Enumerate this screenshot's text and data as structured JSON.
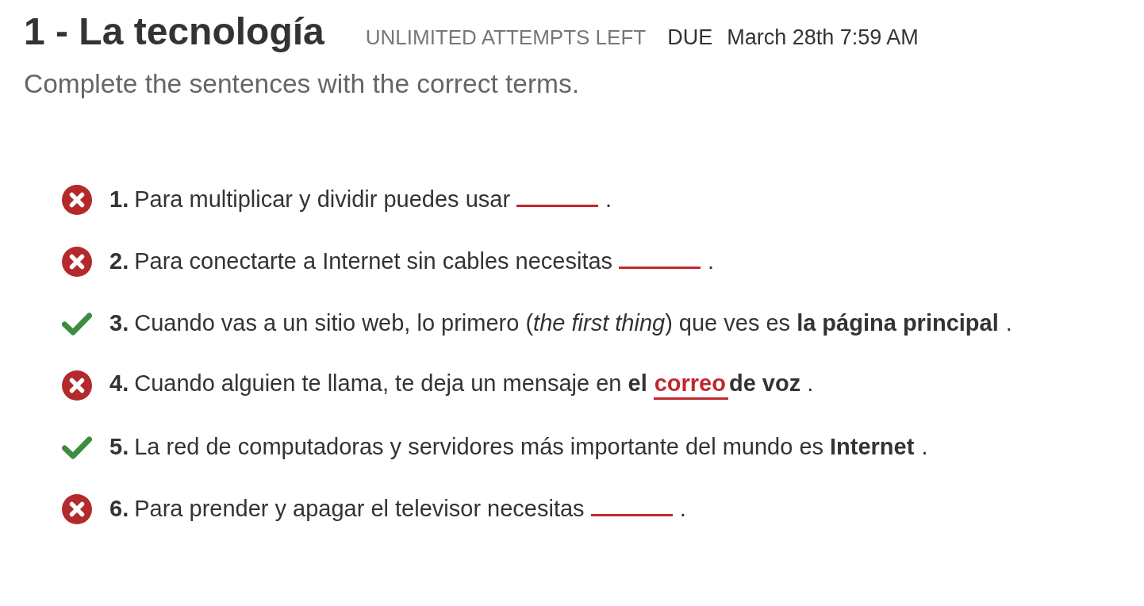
{
  "header": {
    "title": "1 - La tecnología",
    "attempts": "UNLIMITED ATTEMPTS LEFT",
    "due_label": "DUE",
    "due_date": "March 28th 7:59 AM"
  },
  "instructions": "Complete the sentences with the correct terms.",
  "items": [
    {
      "number": "1.",
      "correct": false,
      "parts": [
        {
          "kind": "text",
          "text": "Para multiplicar y dividir puedes usar"
        },
        {
          "kind": "answer"
        },
        {
          "kind": "text",
          "text": "."
        }
      ]
    },
    {
      "number": "2.",
      "correct": false,
      "parts": [
        {
          "kind": "text",
          "text": "Para conectarte a Internet sin cables necesitas"
        },
        {
          "kind": "answer"
        },
        {
          "kind": "text",
          "text": "."
        }
      ]
    },
    {
      "number": "3.",
      "correct": true,
      "parts": [
        {
          "kind": "text",
          "text": "Cuando vas a un sitio web, lo primero (*the first thing*) que ves es"
        },
        {
          "kind": "answer",
          "value": "la página principal"
        },
        {
          "kind": "text",
          "text": "."
        }
      ]
    },
    {
      "number": "4.",
      "correct": false,
      "parts": [
        {
          "kind": "text",
          "text": "Cuando alguien te llama, te deja un mensaje en **el**"
        },
        {
          "kind": "answer",
          "value": "correo"
        },
        {
          "kind": "text",
          "text": "**de voz** ."
        }
      ]
    },
    {
      "number": "5.",
      "correct": true,
      "parts": [
        {
          "kind": "text",
          "text": "La red de computadoras y servidores más importante del mundo es"
        },
        {
          "kind": "answer",
          "value": "Internet"
        },
        {
          "kind": "text",
          "text": "."
        }
      ]
    },
    {
      "number": "6.",
      "correct": false,
      "parts": [
        {
          "kind": "text",
          "text": "Para prender y apagar el televisor necesitas"
        },
        {
          "kind": "answer"
        },
        {
          "kind": "text",
          "text": "."
        }
      ]
    }
  ]
}
